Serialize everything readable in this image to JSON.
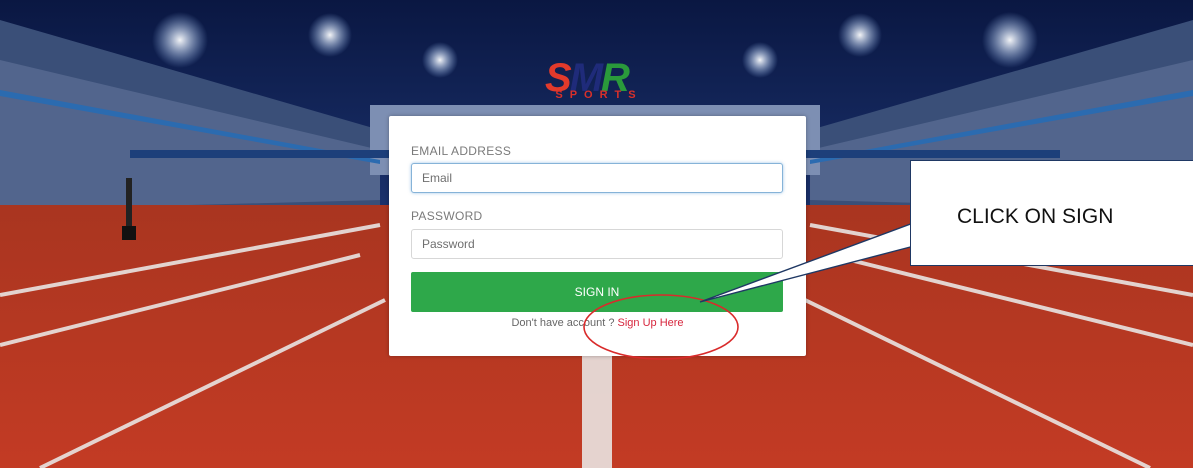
{
  "logo": {
    "s": "S",
    "m": "M",
    "r": "R",
    "sub": "SPORTS"
  },
  "form": {
    "email_label": "EMAIL ADDRESS",
    "email_placeholder": "Email",
    "password_label": "PASSWORD",
    "password_placeholder": "Password",
    "signin_label": "SIGN IN",
    "signup_prompt": "Don't have account ? ",
    "signup_link": "Sign Up Here"
  },
  "annotation": {
    "callout_text": "CLICK ON SIGN"
  },
  "colors": {
    "primary_button": "#2ea84a",
    "link": "#d7263d",
    "annotation_ellipse": "#d92b2b",
    "track": "#b8331f"
  }
}
